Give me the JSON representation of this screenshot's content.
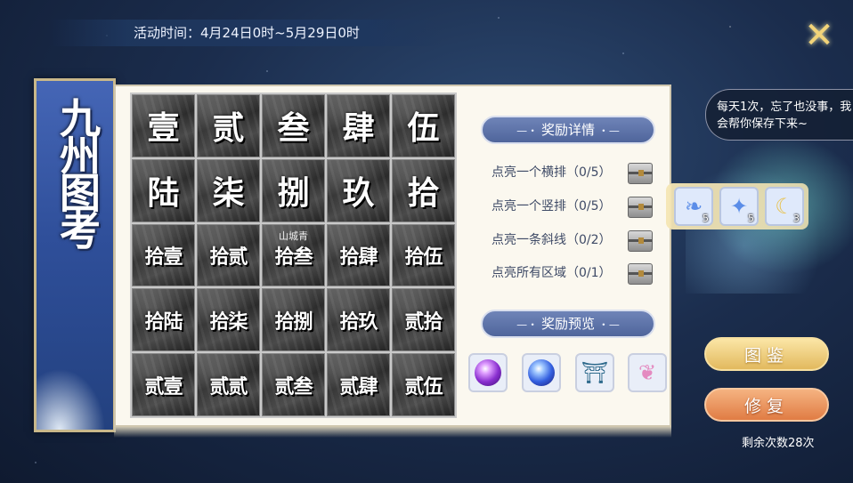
{
  "activity_time": "活动时间：4月24日0时~5月29日0时",
  "banner_title": "九州图考",
  "grid": [
    [
      "壹",
      "贰",
      "叁",
      "肆",
      "伍"
    ],
    [
      "陆",
      "柒",
      "捌",
      "玖",
      "拾"
    ],
    [
      "拾壹",
      "拾贰",
      "拾叁",
      "拾肆",
      "拾伍"
    ],
    [
      "拾陆",
      "拾柒",
      "拾捌",
      "拾玖",
      "贰拾"
    ],
    [
      "贰壹",
      "贰贰",
      "贰叁",
      "贰肆",
      "贰伍"
    ]
  ],
  "grid_sign": "山城青",
  "rewards_detail_header": "奖励详情",
  "tasks": [
    {
      "label": "点亮一个横排（0/5）"
    },
    {
      "label": "点亮一个竖排（0/5）"
    },
    {
      "label": "点亮一条斜线（0/2）"
    },
    {
      "label": "点亮所有区域（0/1）"
    }
  ],
  "rewards_preview_header": "奖励预览",
  "preview_items": [
    {
      "icon": "purple-orb-icon"
    },
    {
      "icon": "blue-orb-icon"
    },
    {
      "icon": "pavilion-icon"
    },
    {
      "icon": "butterfly-icon"
    }
  ],
  "speech_text": "每天1次，忘了也没事，我会帮你保存下来~",
  "side_rewards": [
    {
      "icon": "blue-feather-icon",
      "count": "5"
    },
    {
      "icon": "star-crystal-icon",
      "count": "5"
    },
    {
      "icon": "moon-charm-icon",
      "count": "3"
    }
  ],
  "buttons": {
    "atlas": "图鉴",
    "repair": "修复"
  },
  "remaining_text": "剩余次数28次",
  "colors": {
    "board": "#fbf8ef",
    "header_bar": "#5a6fa8",
    "atlas_button": "#e2b95e",
    "repair_button": "#e07c44"
  }
}
